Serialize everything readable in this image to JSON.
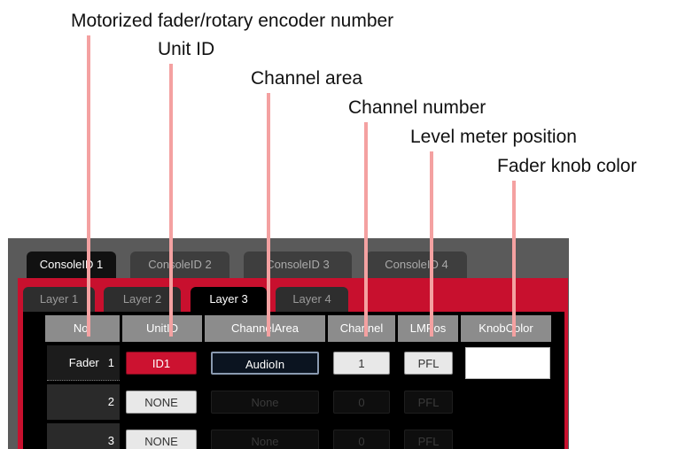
{
  "callouts": {
    "fader_encoder_number": "Motorized fader/rotary encoder number",
    "unit_id": "Unit ID",
    "channel_area": "Channel area",
    "channel_number": "Channel number",
    "level_meter_position": "Level meter position",
    "fader_knob_color": "Fader knob color"
  },
  "colors": {
    "pointer_line": "#f4a1a1",
    "accent_red": "#c8102e",
    "unit_red": "#cc1230"
  },
  "console_tabs": [
    "ConsoleID 1",
    "ConsoleID 2",
    "ConsoleID 3",
    "ConsoleID 4"
  ],
  "active_console_tab": "ConsoleID 1",
  "layer_tabs": [
    "Layer 1",
    "Layer 2",
    "Layer 3",
    "Layer 4"
  ],
  "active_layer_tab": "Layer 3",
  "columns": [
    "No.",
    "UnitID",
    "ChannelArea",
    "Channel",
    "LMPos",
    "KnobColor"
  ],
  "rows": [
    {
      "label": "Fader",
      "number": "1",
      "unit_id": "ID1",
      "channel_area": "AudioIn",
      "channel": "1",
      "lm_pos": "PFL",
      "knob_color": "white"
    },
    {
      "label": "",
      "number": "2",
      "unit_id": "NONE",
      "channel_area": "None",
      "channel": "0",
      "lm_pos": "PFL",
      "knob_color": ""
    },
    {
      "label": "",
      "number": "3",
      "unit_id": "NONE",
      "channel_area": "None",
      "channel": "0",
      "lm_pos": "PFL",
      "knob_color": ""
    }
  ]
}
